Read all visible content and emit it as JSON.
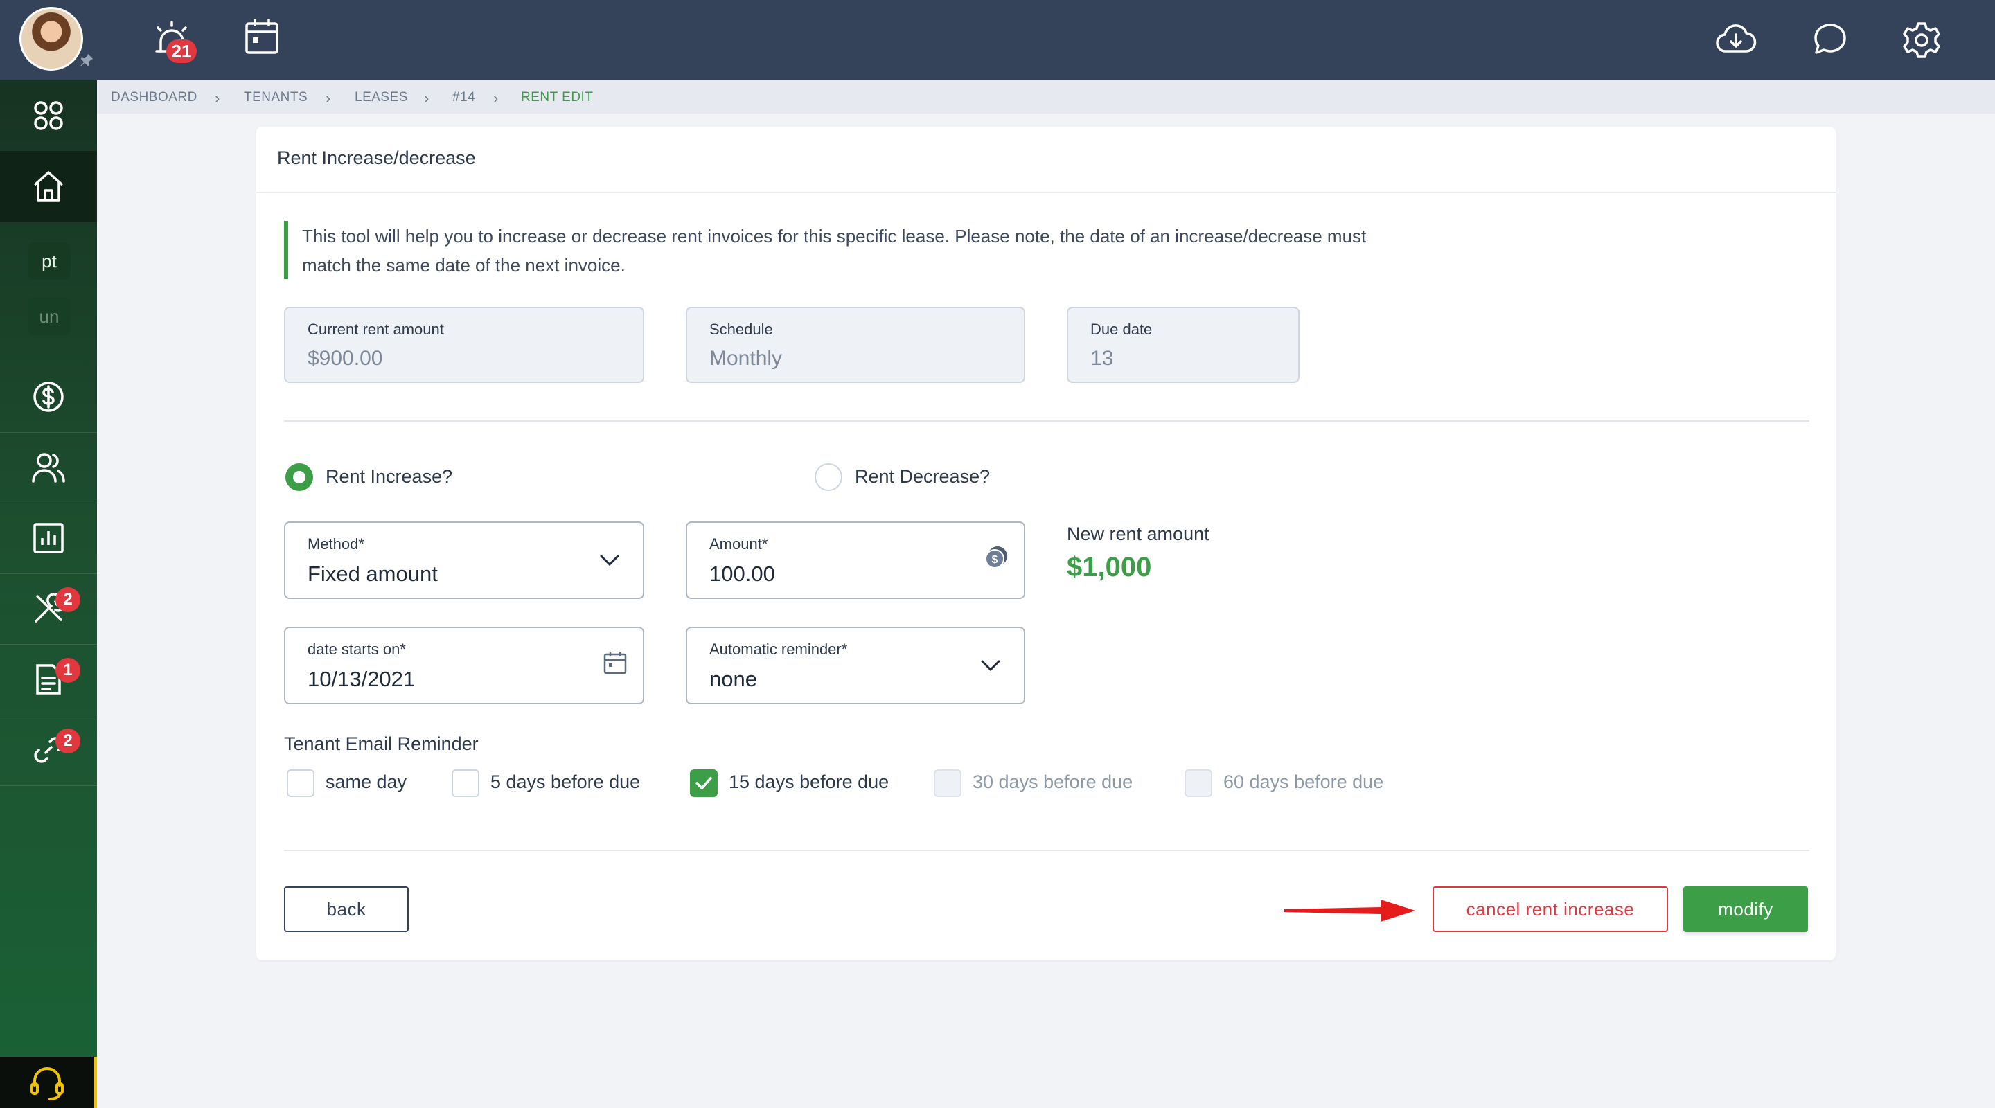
{
  "topbar": {
    "notifications_count": "21",
    "icons": [
      "alarm-icon",
      "calendar-icon",
      "cloud-download-icon",
      "chat-icon",
      "gear-icon"
    ]
  },
  "sidebar": {
    "items": [
      {
        "icon": "apps-grid-icon"
      },
      {
        "icon": "home-icon",
        "active": true
      },
      {
        "icon": "dollar-icon"
      },
      {
        "icon": "users-icon"
      },
      {
        "icon": "report-chart-icon"
      },
      {
        "icon": "tools-icon",
        "badge": "2"
      },
      {
        "icon": "document-icon",
        "badge": "1"
      },
      {
        "icon": "link-icon",
        "badge": "2"
      }
    ],
    "pills": [
      "pt",
      "un"
    ],
    "support_icon": "headset-icon"
  },
  "breadcrumb": [
    "DASHBOARD",
    "TENANTS",
    "LEASES",
    "#14",
    "RENT EDIT"
  ],
  "card": {
    "title": "Rent Increase/decrease",
    "info": "This tool will help you to increase or decrease rent invoices for this specific lease. Please note, the date of an increase/decrease must match the same date of the next invoice."
  },
  "readonly_fields": {
    "current_rent": {
      "label": "Current rent amount",
      "value": "$900.00"
    },
    "schedule": {
      "label": "Schedule",
      "value": "Monthly"
    },
    "due_date": {
      "label": "Due date",
      "value": "13"
    }
  },
  "options": {
    "increase_label": "Rent Increase?",
    "decrease_label": "Rent Decrease?",
    "selected": "increase"
  },
  "form": {
    "method": {
      "label": "Method*",
      "value": "Fixed amount"
    },
    "amount": {
      "label": "Amount*",
      "value": "100.00"
    },
    "date_starts": {
      "label": "date starts on*",
      "value": "10/13/2021"
    },
    "reminder": {
      "label": "Automatic reminder*",
      "value": "none"
    }
  },
  "new_rent": {
    "label": "New rent amount",
    "value": "$1,000"
  },
  "email_reminder": {
    "label": "Tenant Email Reminder",
    "options": [
      {
        "label": "same day",
        "checked": false,
        "disabled": false
      },
      {
        "label": "5 days before due",
        "checked": false,
        "disabled": false
      },
      {
        "label": "15 days before due",
        "checked": true,
        "disabled": false
      },
      {
        "label": "30 days before due",
        "checked": false,
        "disabled": true
      },
      {
        "label": "60 days before due",
        "checked": false,
        "disabled": true
      }
    ]
  },
  "buttons": {
    "back": "back",
    "cancel": "cancel rent increase",
    "modify": "modify"
  },
  "colors": {
    "accent_green": "#3c9e47",
    "danger_red": "#e0383e",
    "topbar": "#34435a"
  }
}
